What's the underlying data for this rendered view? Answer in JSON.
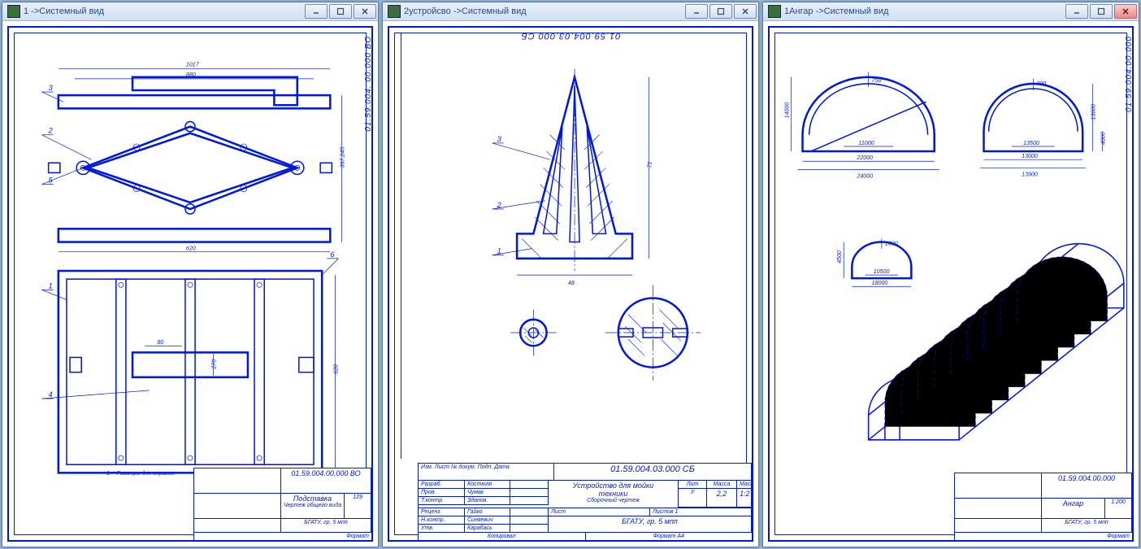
{
  "windows": [
    {
      "title": "1 ->Системный вид",
      "close_red": false,
      "docnum_side": "01.59.004. 00.000 ВО",
      "note": "1. * Размеры для справок.",
      "titleblock": {
        "main_num": "01.59.004.00.000 ВО",
        "name1": "Подставка",
        "name2": "Чертеж общего вида",
        "mass": "129",
        "org": "БГАТУ, гр. 5 мпп",
        "format": "Формат"
      },
      "dims": {
        "d1": "1017",
        "d2": "880",
        "d3": "397,245",
        "d4": "620",
        "d5": "80",
        "d6": "270",
        "d7": "620"
      },
      "callouts": [
        "1",
        "2",
        "3",
        "4",
        "5",
        "6"
      ]
    },
    {
      "title": "2устройсво ->Системный вид",
      "close_red": false,
      "docnum_top": "01.59.004.03.000 СБ",
      "titleblock": {
        "main_num": "01.59.004.03.000 СБ",
        "name1": "Устройство для мойки",
        "name2": "техники",
        "name3": "Сборочный чертеж",
        "lit": "У",
        "mass": "2,2",
        "scale": "1:2",
        "org": "БГАТУ, гр. 5 мпп",
        "sheet": "Лист",
        "sheets": "Листов  1",
        "copy": "Копировал",
        "format": "Формат   А4",
        "roles": [
          "Разраб.",
          "Пров.",
          "Т.контр.",
          "Реценз.",
          "Н.контр.",
          "Утв."
        ],
        "names": [
          "Костюля",
          "Чумак",
          "Зданов.",
          "Гайко",
          "Синяевич",
          "Карабась"
        ],
        "hdr": [
          "Изм.",
          "Лист",
          "№ докум.",
          "Подп.",
          "Дата"
        ]
      },
      "dims": {
        "h": "71",
        "w": "48"
      },
      "callouts": [
        "1",
        "2",
        "3"
      ]
    },
    {
      "title": "1Ангар ->Системный вид",
      "close_red": true,
      "docnum_side": "01.59.004.00.000",
      "titleblock": {
        "main_num": "01.59.004.00.000",
        "name1": "Ангар",
        "mass": "1:200",
        "org": "БГАТУ, гр. 5 мпп",
        "format": "Формат"
      },
      "dims": {
        "a1w": "22000",
        "a1w2": "24000",
        "a1h": "14000",
        "a1r": "750",
        "a1b": "11000",
        "a2w": "13000",
        "a2w2": "13900",
        "a2h": "13000",
        "a2h2": "4000",
        "a2r": "700",
        "a2b": "13500",
        "a3w": "18000",
        "a3h": "4500",
        "a3r": "1000",
        "a3b": "10500"
      }
    }
  ]
}
